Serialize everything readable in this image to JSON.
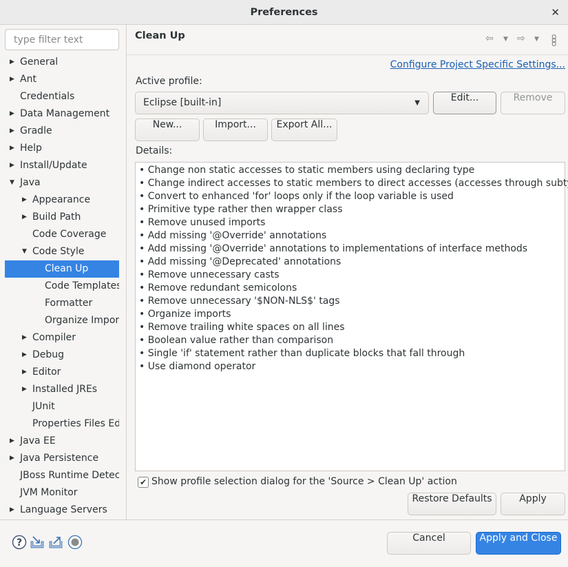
{
  "window": {
    "title": "Preferences",
    "close": "✕"
  },
  "filter": {
    "placeholder": "type filter text"
  },
  "tree": [
    {
      "label": "General",
      "level": 0,
      "arrow": "right"
    },
    {
      "label": "Ant",
      "level": 0,
      "arrow": "right"
    },
    {
      "label": "Credentials",
      "level": 0,
      "arrow": ""
    },
    {
      "label": "Data Management",
      "level": 0,
      "arrow": "right"
    },
    {
      "label": "Gradle",
      "level": 0,
      "arrow": "right"
    },
    {
      "label": "Help",
      "level": 0,
      "arrow": "right"
    },
    {
      "label": "Install/Update",
      "level": 0,
      "arrow": "right"
    },
    {
      "label": "Java",
      "level": 0,
      "arrow": "down"
    },
    {
      "label": "Appearance",
      "level": 1,
      "arrow": "right"
    },
    {
      "label": "Build Path",
      "level": 1,
      "arrow": "right"
    },
    {
      "label": "Code Coverage",
      "level": 1,
      "arrow": ""
    },
    {
      "label": "Code Style",
      "level": 1,
      "arrow": "down"
    },
    {
      "label": "Clean Up",
      "level": 2,
      "arrow": "",
      "selected": true
    },
    {
      "label": "Code Templates",
      "level": 2,
      "arrow": ""
    },
    {
      "label": "Formatter",
      "level": 2,
      "arrow": ""
    },
    {
      "label": "Organize Imports",
      "level": 2,
      "arrow": ""
    },
    {
      "label": "Compiler",
      "level": 1,
      "arrow": "right"
    },
    {
      "label": "Debug",
      "level": 1,
      "arrow": "right"
    },
    {
      "label": "Editor",
      "level": 1,
      "arrow": "right"
    },
    {
      "label": "Installed JREs",
      "level": 1,
      "arrow": "right"
    },
    {
      "label": "JUnit",
      "level": 1,
      "arrow": ""
    },
    {
      "label": "Properties Files Editor",
      "level": 1,
      "arrow": ""
    },
    {
      "label": "Java EE",
      "level": 0,
      "arrow": "right"
    },
    {
      "label": "Java Persistence",
      "level": 0,
      "arrow": "right"
    },
    {
      "label": "JBoss Runtime Detection",
      "level": 0,
      "arrow": ""
    },
    {
      "label": "JVM Monitor",
      "level": 0,
      "arrow": ""
    },
    {
      "label": "Language Servers",
      "level": 0,
      "arrow": "right"
    }
  ],
  "page": {
    "title": "Clean Up",
    "configure_link": "Configure Project Specific Settings...",
    "active_profile_label": "Active profile:",
    "profile_value": "Eclipse [built-in]",
    "edit": "Edit...",
    "remove": "Remove",
    "new": "New...",
    "import": "Import...",
    "export": "Export All...",
    "details_label": "Details:",
    "details": [
      "Change non static accesses to static members using declaring type",
      "Change indirect accesses to static members to direct accesses (accesses through subtypes)",
      "Convert to enhanced 'for' loops only if the loop variable is used",
      "Primitive type rather then wrapper class",
      "Remove unused imports",
      "Add missing '@Override' annotations",
      "Add missing '@Override' annotations to implementations of interface methods",
      "Add missing '@Deprecated' annotations",
      "Remove unnecessary casts",
      "Remove redundant semicolons",
      "Remove unnecessary '$NON-NLS$' tags",
      "Organize imports",
      "Remove trailing white spaces on all lines",
      "Boolean value rather than comparison",
      "Single 'if' statement rather than duplicate blocks that fall through",
      "Use diamond operator"
    ],
    "show_dialog_label": "Show profile selection dialog for the 'Source > Clean Up' action",
    "show_dialog_checked": true,
    "restore_defaults": "Restore Defaults",
    "apply": "Apply"
  },
  "footer": {
    "cancel": "Cancel",
    "apply_close": "Apply and Close"
  },
  "colors": {
    "accent": "#3584e4",
    "link": "#1a5fb4"
  }
}
